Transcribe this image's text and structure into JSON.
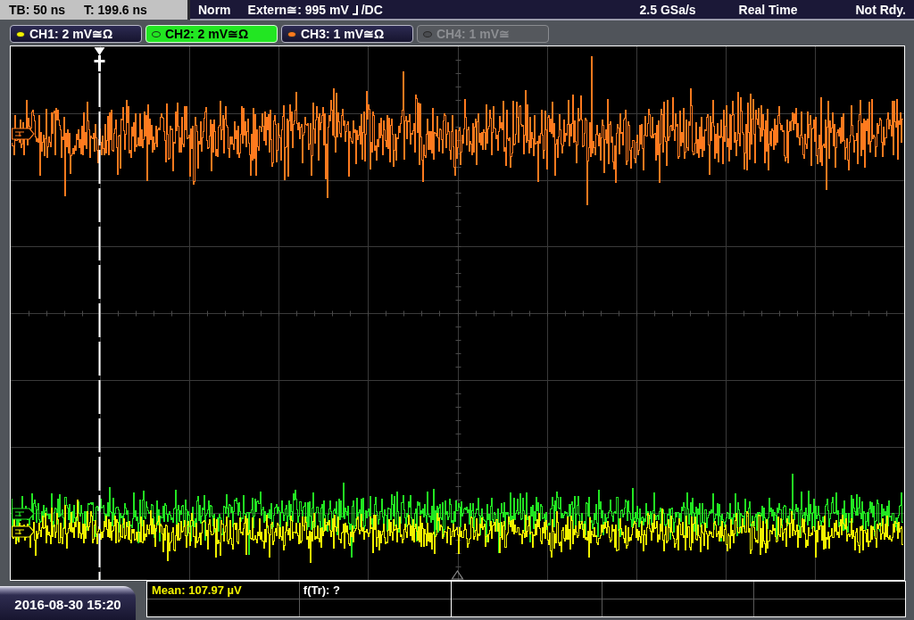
{
  "header": {
    "timebase": "TB: 50 ns",
    "trigger_time": "T: 199.6 ns",
    "trigger_mode": "Norm",
    "trigger_source": "Extern≅: 995 mV",
    "trigger_coupling": "/DC",
    "sample_rate": "2.5 GSa/s",
    "acquisition_mode": "Real Time",
    "status": "Not Rdy."
  },
  "channels": [
    {
      "label": "CH1: 2 mV≅Ω",
      "color": "#f2f200",
      "selected": false,
      "enabled": true
    },
    {
      "label": "CH2: 2 mV≅Ω",
      "color": "#22e622",
      "selected": true,
      "enabled": true
    },
    {
      "label": "CH3: 1 mV≅Ω",
      "color": "#ff7a1e",
      "selected": false,
      "enabled": true
    },
    {
      "label": "CH4: 1 mV≅",
      "color": "#4a4c50",
      "selected": false,
      "enabled": false
    }
  ],
  "measurements": [
    {
      "text": "Mean: 107.97 µV",
      "color": "#f2f200"
    },
    {
      "text": "f(Tr): ?",
      "color": "#ffffff"
    }
  ],
  "timestamp": "2016-08-30 15:20"
}
